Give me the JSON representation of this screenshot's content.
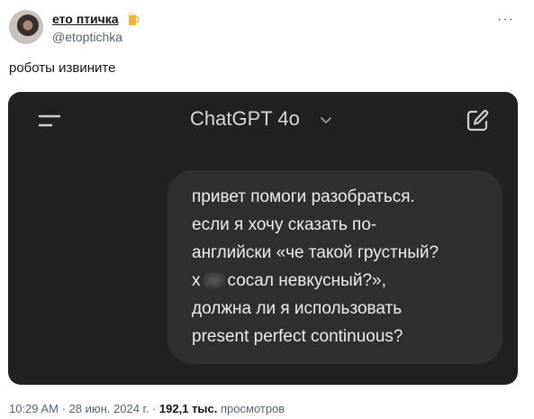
{
  "author": {
    "name": "ето птичка",
    "handle": "@etoptichka",
    "badge_icon": "beer-mug-icon"
  },
  "more_label": "···",
  "tweet": {
    "text": "роботы извините"
  },
  "media": {
    "app_title": "ChatGPT 4o",
    "message_lines": [
      "привет помоги разобраться.",
      "если я хочу сказать по-",
      "английски «че такой грустный?",
      "сосал невкусный?»,",
      "должна ли я использовать",
      "present perfect continuous?"
    ],
    "line4_prefix": "х",
    "line4_censored_word": "уй"
  },
  "meta": {
    "time": "10:29 AM",
    "sep1": "·",
    "date": "28 июн. 2024 г.",
    "sep2": "·",
    "views": "192,1 тыс.",
    "views_label": "просмотров"
  },
  "colors": {
    "media_bg": "#212121",
    "bubble_bg": "#2f2f2f",
    "text_primary": "#0f1419",
    "text_secondary": "#536471"
  }
}
